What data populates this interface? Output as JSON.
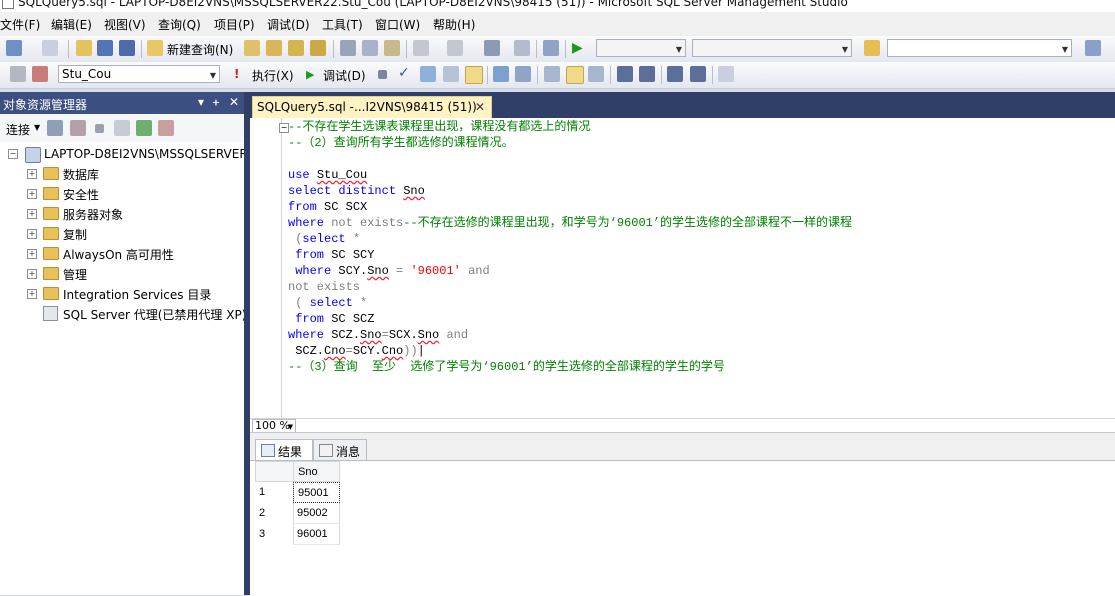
{
  "window": {
    "title": "SQLQuery5.sql - LAPTOP-D8EI2VNS\\MSSQLSERVER22.Stu_Cou (LAPTOP-D8EI2VNS\\98415 (51)) - Microsoft SQL Server Management Studio"
  },
  "menu": [
    "文件(F)",
    "编辑(E)",
    "视图(V)",
    "查询(Q)",
    "项目(P)",
    "调试(D)",
    "工具(T)",
    "窗口(W)",
    "帮助(H)"
  ],
  "toolbar1": {
    "new_query": "新建查询(N)"
  },
  "toolbar2": {
    "database": "Stu_Cou",
    "execute": "执行(X)",
    "debug": "调试(D)"
  },
  "object_explorer": {
    "title": "对象资源管理器",
    "pin_glyphs": [
      "▾",
      "ᚐ",
      "✕"
    ],
    "connect": "连接",
    "server": "LAPTOP-D8EI2VNS\\MSSQLSERVER",
    "nodes": [
      "数据库",
      "安全性",
      "服务器对象",
      "复制",
      "AlwaysOn 高可用性",
      "管理",
      "Integration Services 目录"
    ],
    "agent": "SQL Server 代理(已禁用代理 XP)"
  },
  "document_tab": {
    "label": "SQLQuery5.sql -...I2VNS\\98415 (51))",
    "close": "✕"
  },
  "editor": {
    "lines": [
      "--不存在学生选课表课程里出现，课程没有都选上的情况",
      "--（2）查询所有学生都选修的课程情况。",
      "",
      "use Stu_Cou",
      "select distinct Sno",
      "from SC SCX",
      "where not exists--不存在选修的课程里出现，和学号为‘96001’的学生选修的全部课程不一样的课程",
      " (select *",
      " from SC SCY",
      " where SCY.Sno = '96001' and",
      "not exists",
      " ( select *",
      " from SC SCZ",
      "where SCZ.Sno=SCX.Sno and",
      " SCZ.Cno=SCY.Cno))",
      "--（3）查询  至少  选修了学号为‘96001’的学生选修的全部课程的学生的学号"
    ],
    "zoom": "100 %"
  },
  "results": {
    "tabs": [
      "结果",
      "消息"
    ],
    "columns": [
      "Sno"
    ],
    "rows": [
      [
        "95001"
      ],
      [
        "95002"
      ],
      [
        "96001"
      ]
    ],
    "row_numbers": [
      "1",
      "2",
      "3"
    ]
  }
}
